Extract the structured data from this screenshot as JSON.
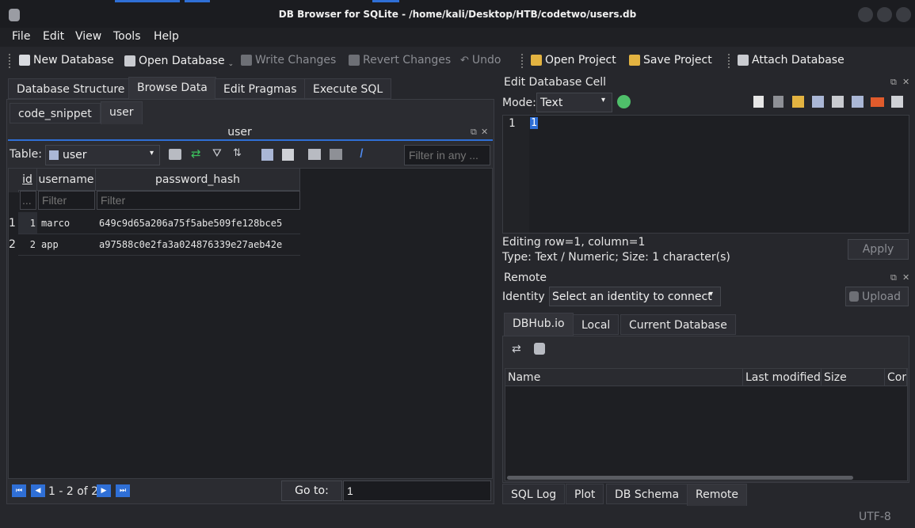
{
  "window": {
    "title": "DB Browser for SQLite - /home/kali/Desktop/HTB/codetwo/users.db"
  },
  "menu": [
    "File",
    "Edit",
    "View",
    "Tools",
    "Help"
  ],
  "toolbar": {
    "new_db": "New Database",
    "open_db": "Open Database",
    "write": "Write Changes",
    "revert": "Revert Changes",
    "undo": "Undo",
    "open_proj": "Open Project",
    "save_proj": "Save Project",
    "attach": "Attach Database"
  },
  "main_tabs": [
    "Database Structure",
    "Browse Data",
    "Edit Pragmas",
    "Execute SQL"
  ],
  "sub_tabs": [
    "code_snippet",
    "user"
  ],
  "browse": {
    "panel_title": "user",
    "table_label": "Table:",
    "table_value": "user",
    "filter_placeholder": "Filter in any ...",
    "columns": [
      "id",
      "username",
      "password_hash"
    ],
    "filter_row": [
      "...",
      "Filter",
      "Filter"
    ],
    "rows": [
      {
        "rownum": "1",
        "id": "1",
        "username": "marco",
        "password_hash": "649c9d65a206a75f5abe509fe128bce5"
      },
      {
        "rownum": "2",
        "id": "2",
        "username": "app",
        "password_hash": "a97588c0e2fa3a024876339e27aeb42e"
      }
    ],
    "pagination": "1 - 2 of 2",
    "goto_label": "Go to:",
    "goto_value": "1"
  },
  "edit_cell": {
    "title": "Edit Database Cell",
    "mode_label": "Mode:",
    "mode_value": "Text",
    "line_no": "1",
    "content": "1",
    "status1": "Editing row=1, column=1",
    "status2": "Type: Text / Numeric; Size: 1 character(s)",
    "apply": "Apply"
  },
  "remote": {
    "title": "Remote",
    "identity_label": "Identity",
    "identity_value": "Select an identity to connect",
    "upload": "Upload",
    "tabs": [
      "DBHub.io",
      "Local",
      "Current Database"
    ],
    "columns": [
      "Name",
      "Last modified",
      "Size",
      "Cor"
    ]
  },
  "bottom_tabs": [
    "SQL Log",
    "Plot",
    "DB Schema",
    "Remote"
  ],
  "statusbar": {
    "encoding": "UTF-8"
  }
}
